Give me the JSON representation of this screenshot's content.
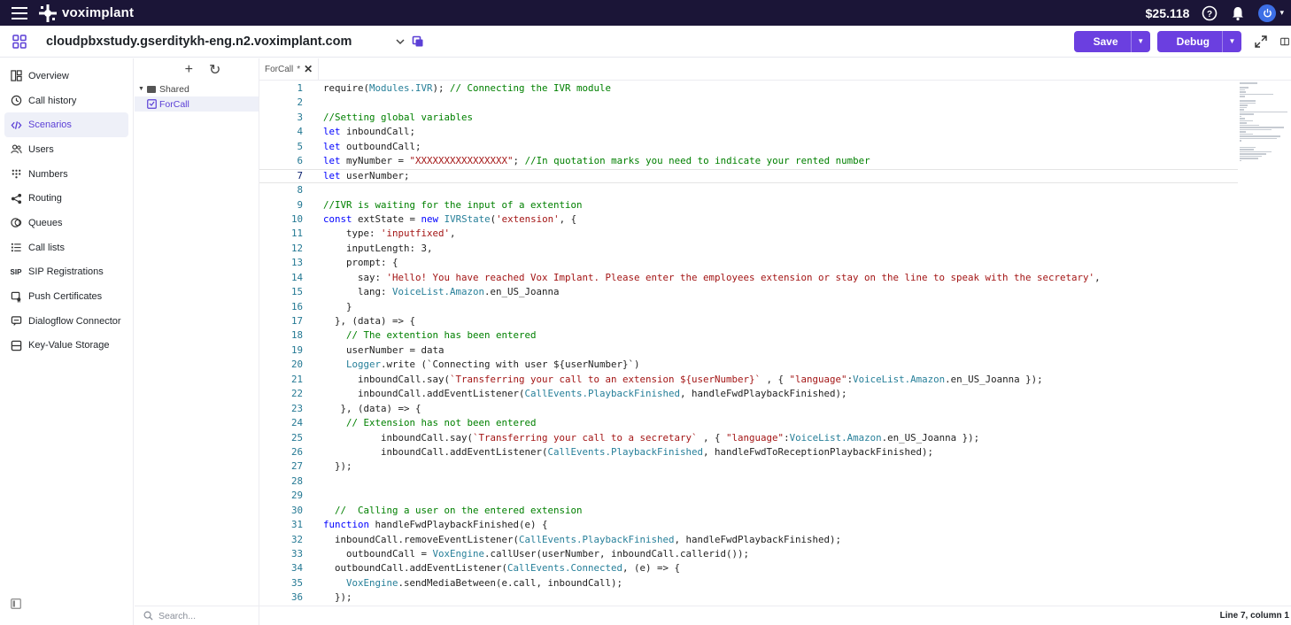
{
  "topbar": {
    "brand": "voximplant",
    "balance": "$25.118"
  },
  "app": {
    "name": "cloudpbxstudy.gserditykh-eng.n2.voximplant.com",
    "save_label": "Save",
    "debug_label": "Debug"
  },
  "sidebar": {
    "items": [
      {
        "label": "Overview",
        "icon": "overview-icon"
      },
      {
        "label": "Call history",
        "icon": "history-icon"
      },
      {
        "label": "Scenarios",
        "icon": "code-icon"
      },
      {
        "label": "Users",
        "icon": "users-icon"
      },
      {
        "label": "Numbers",
        "icon": "dialpad-icon"
      },
      {
        "label": "Routing",
        "icon": "routing-icon"
      },
      {
        "label": "Queues",
        "icon": "queues-icon"
      },
      {
        "label": "Call lists",
        "icon": "list-icon"
      },
      {
        "label": "SIP Registrations",
        "icon": "sip-icon"
      },
      {
        "label": "Push Certificates",
        "icon": "certificate-icon"
      },
      {
        "label": "Dialogflow Connector",
        "icon": "dialogflow-icon"
      },
      {
        "label": "Key-Value Storage",
        "icon": "storage-icon"
      }
    ],
    "active_index": 2
  },
  "filetree": {
    "folder": "Shared",
    "file": "ForCall",
    "search_placeholder": "Search..."
  },
  "editor": {
    "tab_label": "ForCall",
    "tab_modified": "*",
    "current_line": 7,
    "status": "Line 7, column 1"
  },
  "code_lines": [
    [
      [
        "n",
        "require("
      ],
      [
        "t",
        "Modules.IVR"
      ],
      [
        "n",
        "); "
      ],
      [
        "c",
        "// Connecting the IVR module"
      ]
    ],
    [],
    [
      [
        "c",
        "//Setting global variables"
      ]
    ],
    [
      [
        "k",
        "let"
      ],
      [
        "n",
        " inboundCall;"
      ]
    ],
    [
      [
        "k",
        "let"
      ],
      [
        "n",
        " outboundCall;"
      ]
    ],
    [
      [
        "k",
        "let"
      ],
      [
        "n",
        " myNumber = "
      ],
      [
        "s",
        "\"XXXXXXXXXXXXXXXX\""
      ],
      [
        "n",
        "; "
      ],
      [
        "c",
        "//In quotation marks you need to indicate your rented number"
      ]
    ],
    [
      [
        "k",
        "let"
      ],
      [
        "n",
        " userNumber;"
      ]
    ],
    [],
    [
      [
        "c",
        "//IVR is waiting for the input of a extention"
      ]
    ],
    [
      [
        "k",
        "const"
      ],
      [
        "n",
        " extState = "
      ],
      [
        "k",
        "new"
      ],
      [
        "n",
        " "
      ],
      [
        "t",
        "IVRState"
      ],
      [
        "n",
        "("
      ],
      [
        "s",
        "'extension'"
      ],
      [
        "n",
        ", {"
      ]
    ],
    [
      [
        "n",
        "    type: "
      ],
      [
        "s",
        "'inputfixed'"
      ],
      [
        "n",
        ","
      ]
    ],
    [
      [
        "n",
        "    inputLength: 3,"
      ]
    ],
    [
      [
        "n",
        "    prompt: {"
      ]
    ],
    [
      [
        "n",
        "      say: "
      ],
      [
        "s",
        "'Hello! You have reached Vox Implant. Please enter the employees extension or stay on the line to speak with the secretary'"
      ],
      [
        "n",
        ","
      ]
    ],
    [
      [
        "n",
        "      lang: "
      ],
      [
        "t",
        "VoiceList.Amazon"
      ],
      [
        "n",
        ".en_US_Joanna"
      ]
    ],
    [
      [
        "n",
        "    }"
      ]
    ],
    [
      [
        "n",
        "  }, (data) => {"
      ]
    ],
    [
      [
        "n",
        "    "
      ],
      [
        "c",
        "// The extention has been entered"
      ]
    ],
    [
      [
        "n",
        "    userNumber = data"
      ]
    ],
    [
      [
        "n",
        "    "
      ],
      [
        "t",
        "Logger"
      ],
      [
        "n",
        ".write (`Connecting with user ${userNumber}`)"
      ]
    ],
    [
      [
        "n",
        "      inboundCall.say("
      ],
      [
        "s",
        "`Transferring your call to an extension ${userNumber}`"
      ],
      [
        "n",
        " , { "
      ],
      [
        "s",
        "\"language\""
      ],
      [
        "n",
        ":"
      ],
      [
        "t",
        "VoiceList.Amazon"
      ],
      [
        "n",
        ".en_US_Joanna });"
      ]
    ],
    [
      [
        "n",
        "      inboundCall.addEventListener("
      ],
      [
        "t",
        "CallEvents.PlaybackFinished"
      ],
      [
        "n",
        ", handleFwdPlaybackFinished);"
      ]
    ],
    [
      [
        "n",
        "   }, (data) => {"
      ]
    ],
    [
      [
        "n",
        "    "
      ],
      [
        "c",
        "// Extension has not been entered"
      ]
    ],
    [
      [
        "n",
        "          inboundCall.say("
      ],
      [
        "s",
        "`Transferring your call to a secretary`"
      ],
      [
        "n",
        " , { "
      ],
      [
        "s",
        "\"language\""
      ],
      [
        "n",
        ":"
      ],
      [
        "t",
        "VoiceList.Amazon"
      ],
      [
        "n",
        ".en_US_Joanna });"
      ]
    ],
    [
      [
        "n",
        "          inboundCall.addEventListener("
      ],
      [
        "t",
        "CallEvents.PlaybackFinished"
      ],
      [
        "n",
        ", handleFwdToReceptionPlaybackFinished);"
      ]
    ],
    [
      [
        "n",
        "  });"
      ]
    ],
    [],
    [],
    [
      [
        "n",
        "  "
      ],
      [
        "c",
        "//  Calling a user on the entered extension"
      ]
    ],
    [
      [
        "k",
        "function"
      ],
      [
        "n",
        " handleFwdPlaybackFinished(e) {"
      ]
    ],
    [
      [
        "n",
        "  inboundCall.removeEventListener("
      ],
      [
        "t",
        "CallEvents.PlaybackFinished"
      ],
      [
        "n",
        ", handleFwdPlaybackFinished);"
      ]
    ],
    [
      [
        "n",
        "    outboundCall = "
      ],
      [
        "t",
        "VoxEngine"
      ],
      [
        "n",
        ".callUser(userNumber, inboundCall.callerid());"
      ]
    ],
    [
      [
        "n",
        "  outboundCall.addEventListener("
      ],
      [
        "t",
        "CallEvents.Connected"
      ],
      [
        "n",
        ", (e) => {"
      ]
    ],
    [
      [
        "n",
        "    "
      ],
      [
        "t",
        "VoxEngine"
      ],
      [
        "n",
        ".sendMediaBetween(e.call, inboundCall);"
      ]
    ],
    [
      [
        "n",
        "  });"
      ]
    ]
  ]
}
